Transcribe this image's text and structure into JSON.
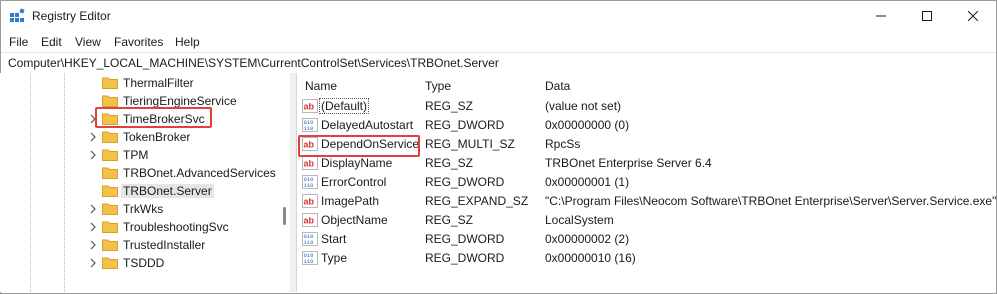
{
  "window": {
    "title": "Registry Editor"
  },
  "menu": [
    "File",
    "Edit",
    "View",
    "Favorites",
    "Help"
  ],
  "address": "Computer\\HKEY_LOCAL_MACHINE\\SYSTEM\\CurrentControlSet\\Services\\TRBOnet.Server",
  "tree": {
    "items": [
      {
        "label": "ThermalFilter",
        "expandable": false
      },
      {
        "label": "TieringEngineService",
        "expandable": false
      },
      {
        "label": "TimeBrokerSvc",
        "expandable": true
      },
      {
        "label": "TokenBroker",
        "expandable": true
      },
      {
        "label": "TPM",
        "expandable": true
      },
      {
        "label": "TRBOnet.AdvancedServices",
        "expandable": false
      },
      {
        "label": "TRBOnet.Server",
        "expandable": false,
        "selected": true
      },
      {
        "label": "TrkWks",
        "expandable": true
      },
      {
        "label": "TroubleshootingSvc",
        "expandable": true
      },
      {
        "label": "TrustedInstaller",
        "expandable": true
      },
      {
        "label": "TSDDD",
        "expandable": true
      }
    ]
  },
  "list": {
    "columns": {
      "name": "Name",
      "type": "Type",
      "data": "Data"
    },
    "rows": [
      {
        "name": "(Default)",
        "type": "REG_SZ",
        "data": "(value not set)",
        "icon": "string-value-icon"
      },
      {
        "name": "DelayedAutostart",
        "type": "REG_DWORD",
        "data": "0x00000000 (0)",
        "icon": "binary-value-icon"
      },
      {
        "name": "DependOnService",
        "type": "REG_MULTI_SZ",
        "data": "RpcSs",
        "icon": "string-value-icon"
      },
      {
        "name": "DisplayName",
        "type": "REG_SZ",
        "data": "TRBOnet Enterprise Server 6.4",
        "icon": "string-value-icon"
      },
      {
        "name": "ErrorControl",
        "type": "REG_DWORD",
        "data": "0x00000001 (1)",
        "icon": "binary-value-icon"
      },
      {
        "name": "ImagePath",
        "type": "REG_EXPAND_SZ",
        "data": "\"C:\\Program Files\\Neocom Software\\TRBOnet Enterprise\\Server\\Server.Service.exe\"",
        "icon": "string-value-icon"
      },
      {
        "name": "ObjectName",
        "type": "REG_SZ",
        "data": "LocalSystem",
        "icon": "string-value-icon"
      },
      {
        "name": "Start",
        "type": "REG_DWORD",
        "data": "0x00000002 (2)",
        "icon": "binary-value-icon"
      },
      {
        "name": "Type",
        "type": "REG_DWORD",
        "data": "0x00000010 (16)",
        "icon": "binary-value-icon"
      }
    ]
  },
  "colors": {
    "highlight": "#e2403d",
    "folder": "#f3c04a",
    "selection": "#e5e5e5"
  }
}
